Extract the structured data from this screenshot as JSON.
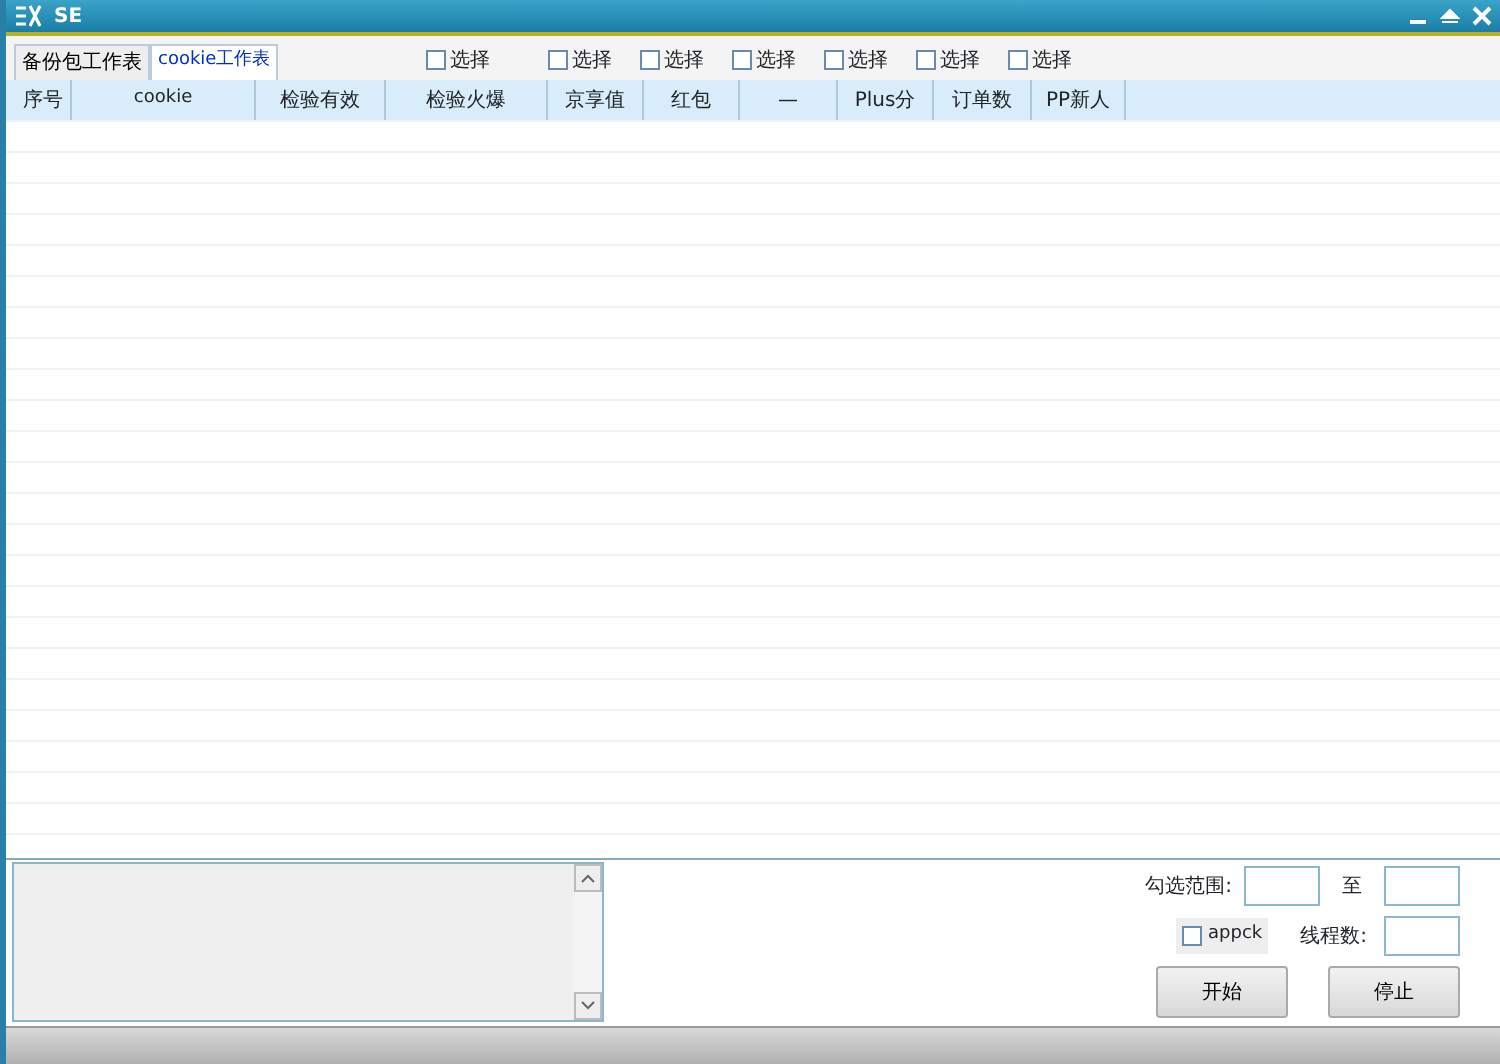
{
  "window": {
    "title": "SE"
  },
  "tabs": [
    {
      "label": "备份包工作表",
      "selected": false
    },
    {
      "label": "cookie工作表",
      "selected": true
    }
  ],
  "select_checkboxes": [
    {
      "label": "选择",
      "checked": false
    },
    {
      "label": "选择",
      "checked": false
    },
    {
      "label": "选择",
      "checked": false
    },
    {
      "label": "选择",
      "checked": false
    },
    {
      "label": "选择",
      "checked": false
    },
    {
      "label": "选择",
      "checked": false
    },
    {
      "label": "选择",
      "checked": false
    }
  ],
  "table": {
    "columns": [
      "序号",
      "cookie",
      "检验有效",
      "检验火爆",
      "京享值",
      "红包",
      "—",
      "Plus分",
      "订单数",
      "PP新人"
    ]
  },
  "controls": {
    "range_label": "勾选范围:",
    "range_to": "至",
    "appck": {
      "label": "appck",
      "checked": false
    },
    "threads_label": "线程数:",
    "buttons": [
      "开始",
      "停止"
    ]
  }
}
